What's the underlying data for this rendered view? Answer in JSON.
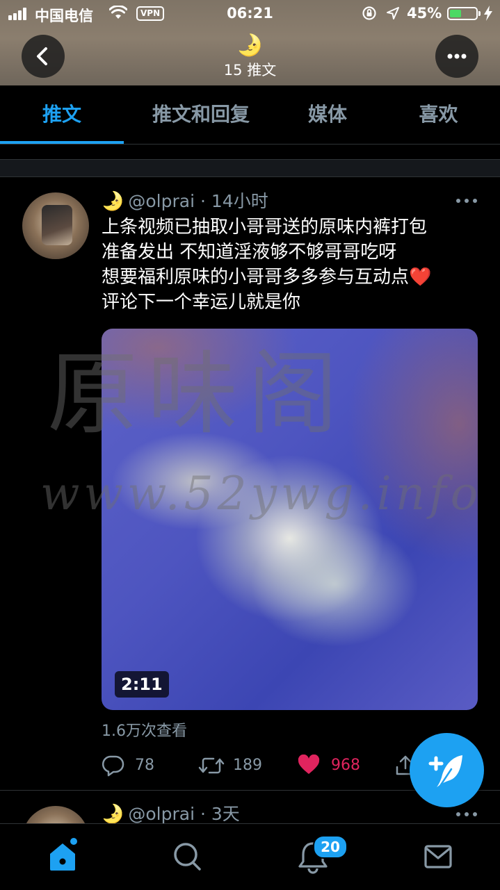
{
  "status_bar": {
    "carrier": "中国电信",
    "vpn": "VPN",
    "time": "06:21",
    "battery_percent": "45%",
    "battery_level": 0.45
  },
  "header": {
    "emoji": "🌛",
    "tweet_count": "15 推文",
    "back_icon": "chevron-left-icon",
    "more_icon": "more-horizontal-icon"
  },
  "tabs": [
    {
      "label": "推文",
      "active": true
    },
    {
      "label": "推文和回复",
      "active": false
    },
    {
      "label": "媒体",
      "active": false
    },
    {
      "label": "喜欢",
      "active": false
    }
  ],
  "tweet": {
    "emoji": "🌛",
    "handle": "@olprai",
    "separator": "·",
    "time": "14小时",
    "text_lines": [
      "上条视频已抽取小哥哥送的原味内裤打包",
      "准备发出 不知道淫液够不够哥哥吃呀",
      "想要福利原味的小哥哥多多参与互动点",
      "评论下一个幸运儿就是你"
    ],
    "heart_emoji": "❤️",
    "video_duration": "2:11",
    "watermark_title": "原味阁",
    "watermark_url": "www.52ywg.info",
    "views": "1.6万次查看",
    "replies": "78",
    "retweets": "189",
    "likes": "968"
  },
  "tweet2": {
    "emoji": "🌛",
    "handle": "@olprai",
    "separator": "·",
    "time": "3天"
  },
  "bottom_nav": {
    "items": [
      "home-icon",
      "search-icon",
      "notifications-icon",
      "messages-icon"
    ],
    "notification_badge": "20"
  },
  "colors": {
    "accent": "#1da1f2",
    "like": "#e0245e",
    "muted": "#8899a6",
    "background": "#000000"
  }
}
